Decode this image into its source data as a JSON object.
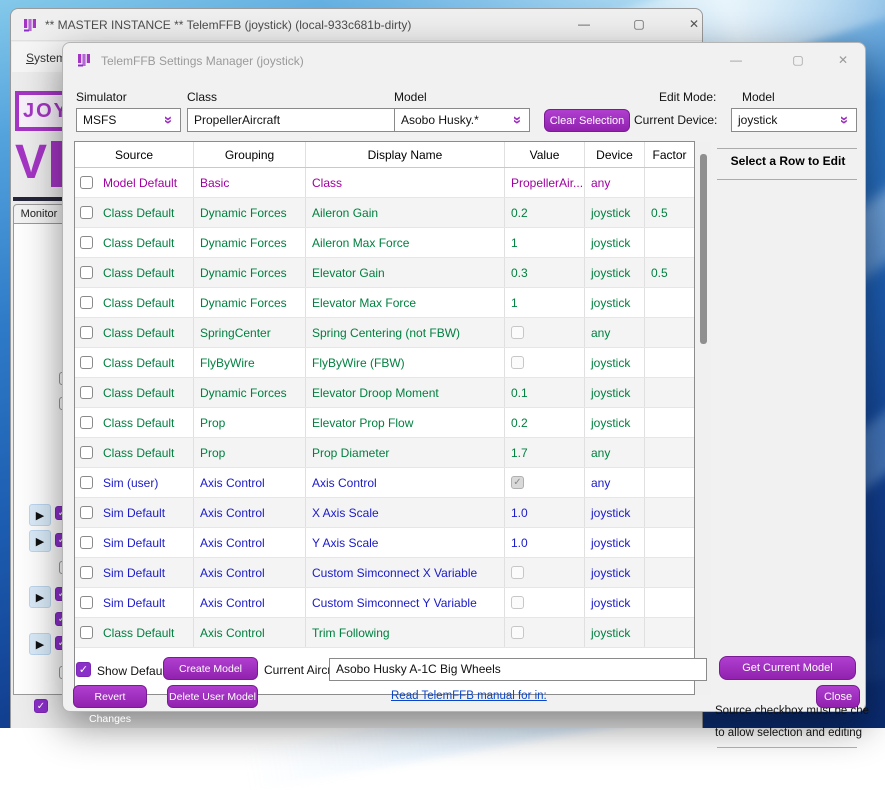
{
  "icons": {
    "minimize": "—",
    "maximize": "▢",
    "close": "✕",
    "dropdown_chevron": "»",
    "checkmark": "✓",
    "play_arrow": "▶"
  },
  "colors": {
    "accent_purple": "#a22db8",
    "row_model": "#a000a0",
    "row_class": "#008040",
    "row_sim": "#1a1ac8",
    "link_blue": "#0a46c8"
  },
  "main_window": {
    "title": "** MASTER INSTANCE ** TelemFFB (joystick) (local-933c681b-dirty)",
    "menu": {
      "accel": "S",
      "rest": "ystem"
    },
    "logo_top": "JOY",
    "logo_bottom": "V",
    "monitor_tab": "Monitor"
  },
  "dialog": {
    "title": "TelemFFB Settings Manager (joystick)",
    "controls": {
      "simulator_label": "Simulator",
      "simulator_value": "MSFS",
      "class_label": "Class",
      "class_value": "PropellerAircraft",
      "model_label": "Model",
      "model_value": "Asobo Husky.*",
      "clear_selection_label": "Clear Selection",
      "edit_mode_label": "Edit Mode:",
      "edit_mode_value": "Model",
      "current_device_label": "Current Device:",
      "current_device_value": "joystick"
    },
    "table": {
      "headers": [
        "Source",
        "Grouping",
        "Display Name",
        "Value",
        "Device",
        "Factor"
      ],
      "rows": [
        {
          "source": "Model Default",
          "grouping": "Basic",
          "display_name": "Class",
          "value": "PropellerAir...",
          "value_is_checkbox": false,
          "checked": false,
          "device": "any",
          "factor": "",
          "tone": "model"
        },
        {
          "source": "Class Default",
          "grouping": "Dynamic Forces",
          "display_name": "Aileron Gain",
          "value": "0.2",
          "value_is_checkbox": false,
          "checked": false,
          "device": "joystick",
          "factor": "0.5",
          "tone": "class"
        },
        {
          "source": "Class Default",
          "grouping": "Dynamic Forces",
          "display_name": "Aileron Max Force",
          "value": "1",
          "value_is_checkbox": false,
          "checked": false,
          "device": "joystick",
          "factor": "",
          "tone": "class"
        },
        {
          "source": "Class Default",
          "grouping": "Dynamic Forces",
          "display_name": "Elevator Gain",
          "value": "0.3",
          "value_is_checkbox": false,
          "checked": false,
          "device": "joystick",
          "factor": "0.5",
          "tone": "class"
        },
        {
          "source": "Class Default",
          "grouping": "Dynamic Forces",
          "display_name": "Elevator Max Force",
          "value": "1",
          "value_is_checkbox": false,
          "checked": false,
          "device": "joystick",
          "factor": "",
          "tone": "class"
        },
        {
          "source": "Class Default",
          "grouping": "SpringCenter",
          "display_name": "Spring Centering (not FBW)",
          "value": "",
          "value_is_checkbox": true,
          "checked": false,
          "device": "any",
          "factor": "",
          "tone": "class"
        },
        {
          "source": "Class Default",
          "grouping": "FlyByWire",
          "display_name": "FlyByWire (FBW)",
          "value": "",
          "value_is_checkbox": true,
          "checked": false,
          "device": "joystick",
          "factor": "",
          "tone": "class"
        },
        {
          "source": "Class Default",
          "grouping": "Dynamic Forces",
          "display_name": "Elevator Droop Moment",
          "value": "0.1",
          "value_is_checkbox": false,
          "checked": false,
          "device": "joystick",
          "factor": "",
          "tone": "class"
        },
        {
          "source": "Class Default",
          "grouping": "Prop",
          "display_name": "Elevator Prop Flow",
          "value": "0.2",
          "value_is_checkbox": false,
          "checked": false,
          "device": "joystick",
          "factor": "",
          "tone": "class"
        },
        {
          "source": "Class Default",
          "grouping": "Prop",
          "display_name": "Prop Diameter",
          "value": "1.7",
          "value_is_checkbox": false,
          "checked": false,
          "device": "any",
          "factor": "",
          "tone": "class"
        },
        {
          "source": "Sim (user)",
          "grouping": "Axis Control",
          "display_name": "Axis Control",
          "value": "",
          "value_is_checkbox": true,
          "checked": true,
          "device": "any",
          "factor": "",
          "tone": "sim"
        },
        {
          "source": "Sim Default",
          "grouping": "Axis Control",
          "display_name": "X Axis Scale",
          "value": "1.0",
          "value_is_checkbox": false,
          "checked": false,
          "device": "joystick",
          "factor": "",
          "tone": "sim"
        },
        {
          "source": "Sim Default",
          "grouping": "Axis Control",
          "display_name": "Y Axis Scale",
          "value": "1.0",
          "value_is_checkbox": false,
          "checked": false,
          "device": "joystick",
          "factor": "",
          "tone": "sim"
        },
        {
          "source": "Sim Default",
          "grouping": "Axis Control",
          "display_name": "Custom Simconnect X Variable",
          "value": "",
          "value_is_checkbox": true,
          "checked": false,
          "device": "joystick",
          "factor": "",
          "tone": "sim"
        },
        {
          "source": "Sim Default",
          "grouping": "Axis Control",
          "display_name": "Custom Simconnect Y Variable",
          "value": "",
          "value_is_checkbox": true,
          "checked": false,
          "device": "joystick",
          "factor": "",
          "tone": "sim"
        },
        {
          "source": "Class Default",
          "grouping": "Axis Control",
          "display_name": "Trim Following",
          "value": "",
          "value_is_checkbox": true,
          "checked": false,
          "device": "joystick",
          "factor": "",
          "tone": "class"
        }
      ]
    },
    "right_panel": {
      "title": "Select a Row to Edit",
      "info_line1": "Source checkbox must be che",
      "info_line2": "to allow selection and editing"
    },
    "bottom": {
      "show_defaults_label": "Show Defaults",
      "create_model_label": "Create Model Setting",
      "current_aircraft_label": "Current Aircraft:",
      "current_aircraft_value": "Asobo Husky A-1C Big Wheels",
      "get_current_model_label": "Get Current Model",
      "revert_changes_label": "Revert Changes",
      "delete_user_model_label": "Delete User Model",
      "manual_link": "Read TelemFFB manual for in:",
      "close_label": "Close"
    }
  }
}
